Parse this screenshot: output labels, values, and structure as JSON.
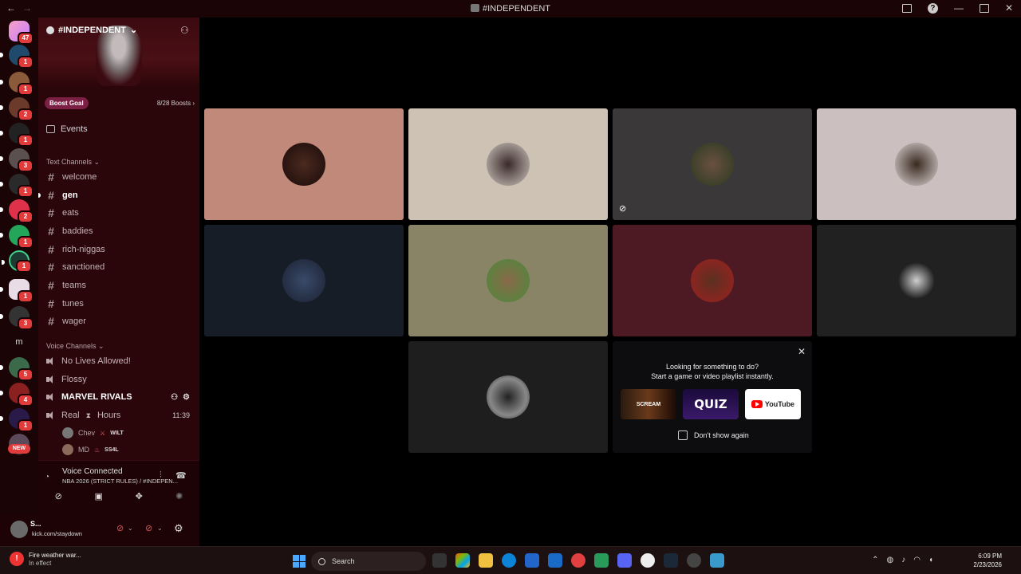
{
  "window": {
    "title": "#INDEPENDENT",
    "back_glyph": "←",
    "forward_glyph": "→"
  },
  "server_rail": {
    "badges": [
      "47",
      "1",
      "1",
      "2",
      "1",
      "3",
      "1",
      "2",
      "1",
      "1",
      "1",
      "3",
      "1",
      "5",
      "4",
      "1",
      "1"
    ],
    "letter_server": "m",
    "new_label": "NEW"
  },
  "server": {
    "name": "#INDEPENDENT",
    "boost_goal_label": "Boost Goal",
    "boost_count": "8/28 Boosts",
    "events_label": "Events"
  },
  "text_channels": {
    "header": "Text Channels",
    "items": [
      "welcome",
      "gen",
      "eats",
      "baddies",
      "rich-niggas",
      "sanctioned",
      "teams",
      "tunes",
      "wager"
    ],
    "active": "gen"
  },
  "voice_channels": {
    "header": "Voice Channels",
    "items": [
      {
        "name": "No Lives Allowed!"
      },
      {
        "name": "Flossy"
      },
      {
        "name": "MARVEL RIVALS",
        "active": true
      },
      {
        "name": "Real",
        "name_suffix": "Hours",
        "time": "11:39"
      }
    ],
    "users": [
      {
        "name": "Chev",
        "tag": "WILT"
      },
      {
        "name": "MD",
        "tag": "SS4L"
      }
    ]
  },
  "voice_panel": {
    "status": "Voice Connected",
    "channel": "NBA 2026 (STRICT RULES) / #INDEPEN..."
  },
  "user_panel": {
    "username": "S...",
    "status": "kick.com/staydown"
  },
  "stage": {
    "tile_colors": [
      "#c0897a",
      "#cdc2b3",
      "#3a3838",
      "#cbc0bf",
      "#171d26",
      "#8a8466",
      "#4d1a23",
      "#212121",
      "#1e1e1e"
    ],
    "promo": {
      "line1": "Looking for something to do?",
      "line2": "Start a game or video playlist instantly.",
      "apps": [
        "SCREAM",
        "QUIZ",
        "YouTube"
      ],
      "checkbox_label": "Don't show again"
    }
  },
  "taskbar": {
    "weather_title": "Fire weather war...",
    "weather_sub": "In effect",
    "search_placeholder": "Search",
    "time": "6:09 PM",
    "date": "2/23/2026"
  },
  "colors": {
    "sidebar_bg": "#2a0509",
    "rail_bg": "#1a0406",
    "badge_red": "#e23b3b",
    "boost_pill": "#7b1f45"
  }
}
